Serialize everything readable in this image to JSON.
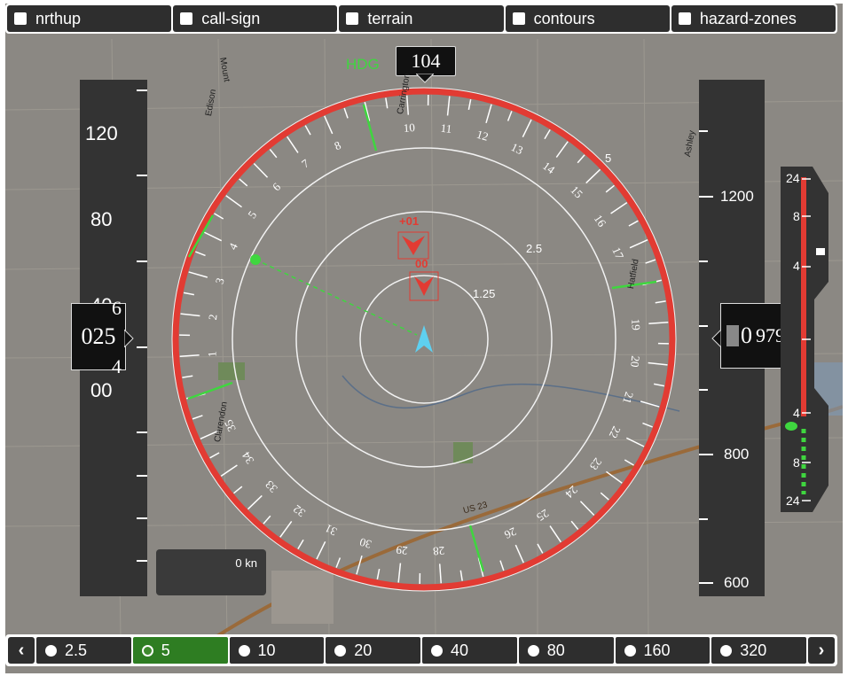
{
  "toggles": [
    {
      "label": "nrthup",
      "checked": false
    },
    {
      "label": "call-sign",
      "checked": false
    },
    {
      "label": "terrain",
      "checked": false
    },
    {
      "label": "contours",
      "checked": false
    },
    {
      "label": "hazard-zones",
      "checked": false
    }
  ],
  "heading": {
    "label": "HDG",
    "value": "104"
  },
  "airspeed": {
    "value": "025",
    "ticks": [
      "120",
      "80",
      "40",
      "00"
    ],
    "roll_above": "6",
    "roll_below": "4"
  },
  "altitude": {
    "value": "979",
    "lead": "0",
    "ticks": [
      "1200",
      "800",
      "600"
    ]
  },
  "vsi": {
    "ticks": [
      "24",
      "8",
      "4",
      "4",
      "8",
      "24"
    ]
  },
  "groundspeed": {
    "text": "0 kn"
  },
  "compass": {
    "labels": [
      "1",
      "2",
      "3",
      "4",
      "5",
      "6",
      "7",
      "8",
      "10",
      "11",
      "12",
      "13",
      "14",
      "15",
      "16",
      "17",
      "19",
      "20",
      "21",
      "22",
      "23",
      "24",
      "25",
      "26",
      "28",
      "29",
      "30",
      "31",
      "32",
      "33",
      "34",
      "35"
    ],
    "ring_labels": [
      "5",
      "2.5",
      "1.25"
    ]
  },
  "traffic": [
    {
      "label": "+01"
    },
    {
      "label": "00"
    }
  ],
  "map_labels": [
    "Carrington",
    "Ashley",
    "Clarendon",
    "US 23",
    "Mount",
    "Edison",
    "Hatfield"
  ],
  "ranges": [
    {
      "label": "2.5",
      "active": false
    },
    {
      "label": "5",
      "active": true
    },
    {
      "label": "10",
      "active": false
    },
    {
      "label": "20",
      "active": false
    },
    {
      "label": "40",
      "active": false
    },
    {
      "label": "80",
      "active": false
    },
    {
      "label": "160",
      "active": false
    },
    {
      "label": "320",
      "active": false
    }
  ],
  "nav": {
    "prev": "‹",
    "next": "›"
  },
  "colors": {
    "ring": "#e23b33",
    "accent": "#3fd63f",
    "ownship": "#5ed0f0",
    "active_range": "#2e7d22"
  }
}
